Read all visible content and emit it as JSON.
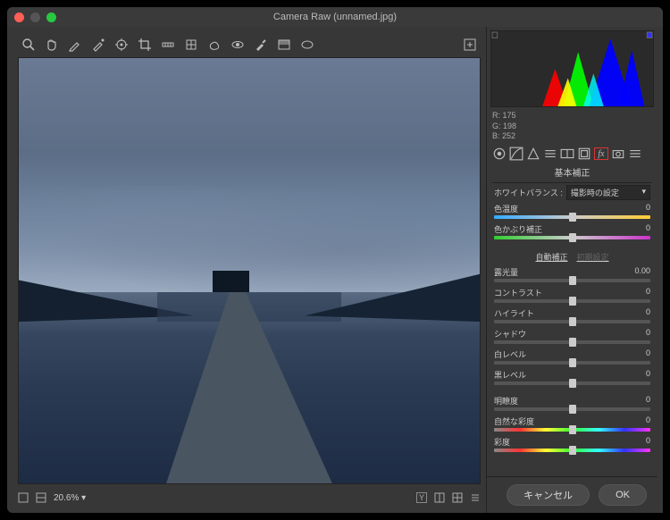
{
  "window": {
    "title": "Camera Raw (unnamed.jpg)"
  },
  "rgb_readout": {
    "r_label": "R:",
    "r": "175",
    "g_label": "G:",
    "g": "198",
    "b_label": "B:",
    "b": "252"
  },
  "zoom": {
    "value": "20.6%",
    "chevron": "▾"
  },
  "panel": {
    "title": "基本補正",
    "wb_label": "ホワイトバランス :",
    "wb_value": "撮影時の設定",
    "auto_label": "自動補正",
    "default_label": "初期設定",
    "sliders": {
      "temp": {
        "label": "色温度",
        "value": "0"
      },
      "tint": {
        "label": "色かぶり補正",
        "value": "0"
      },
      "exposure": {
        "label": "露光量",
        "value": "0.00"
      },
      "contrast": {
        "label": "コントラスト",
        "value": "0"
      },
      "highlight": {
        "label": "ハイライト",
        "value": "0"
      },
      "shadow": {
        "label": "シャドウ",
        "value": "0"
      },
      "white": {
        "label": "白レベル",
        "value": "0"
      },
      "black": {
        "label": "黒レベル",
        "value": "0"
      },
      "clarity": {
        "label": "明瞭度",
        "value": "0"
      },
      "vibrance": {
        "label": "自然な彩度",
        "value": "0"
      },
      "saturation": {
        "label": "彩度",
        "value": "0"
      }
    }
  },
  "buttons": {
    "cancel": "キャンセル",
    "ok": "OK"
  },
  "icons": {
    "zoom": "search",
    "hand": "hand",
    "wb": "eyedrop",
    "color": "eyedrop2",
    "target": "target",
    "crop": "crop",
    "straighten": "ruler",
    "transform": "transform",
    "spot": "heal",
    "eye": "eye",
    "brush": "brush",
    "grad": "gradient",
    "radial": "radial",
    "preset": "preset"
  }
}
